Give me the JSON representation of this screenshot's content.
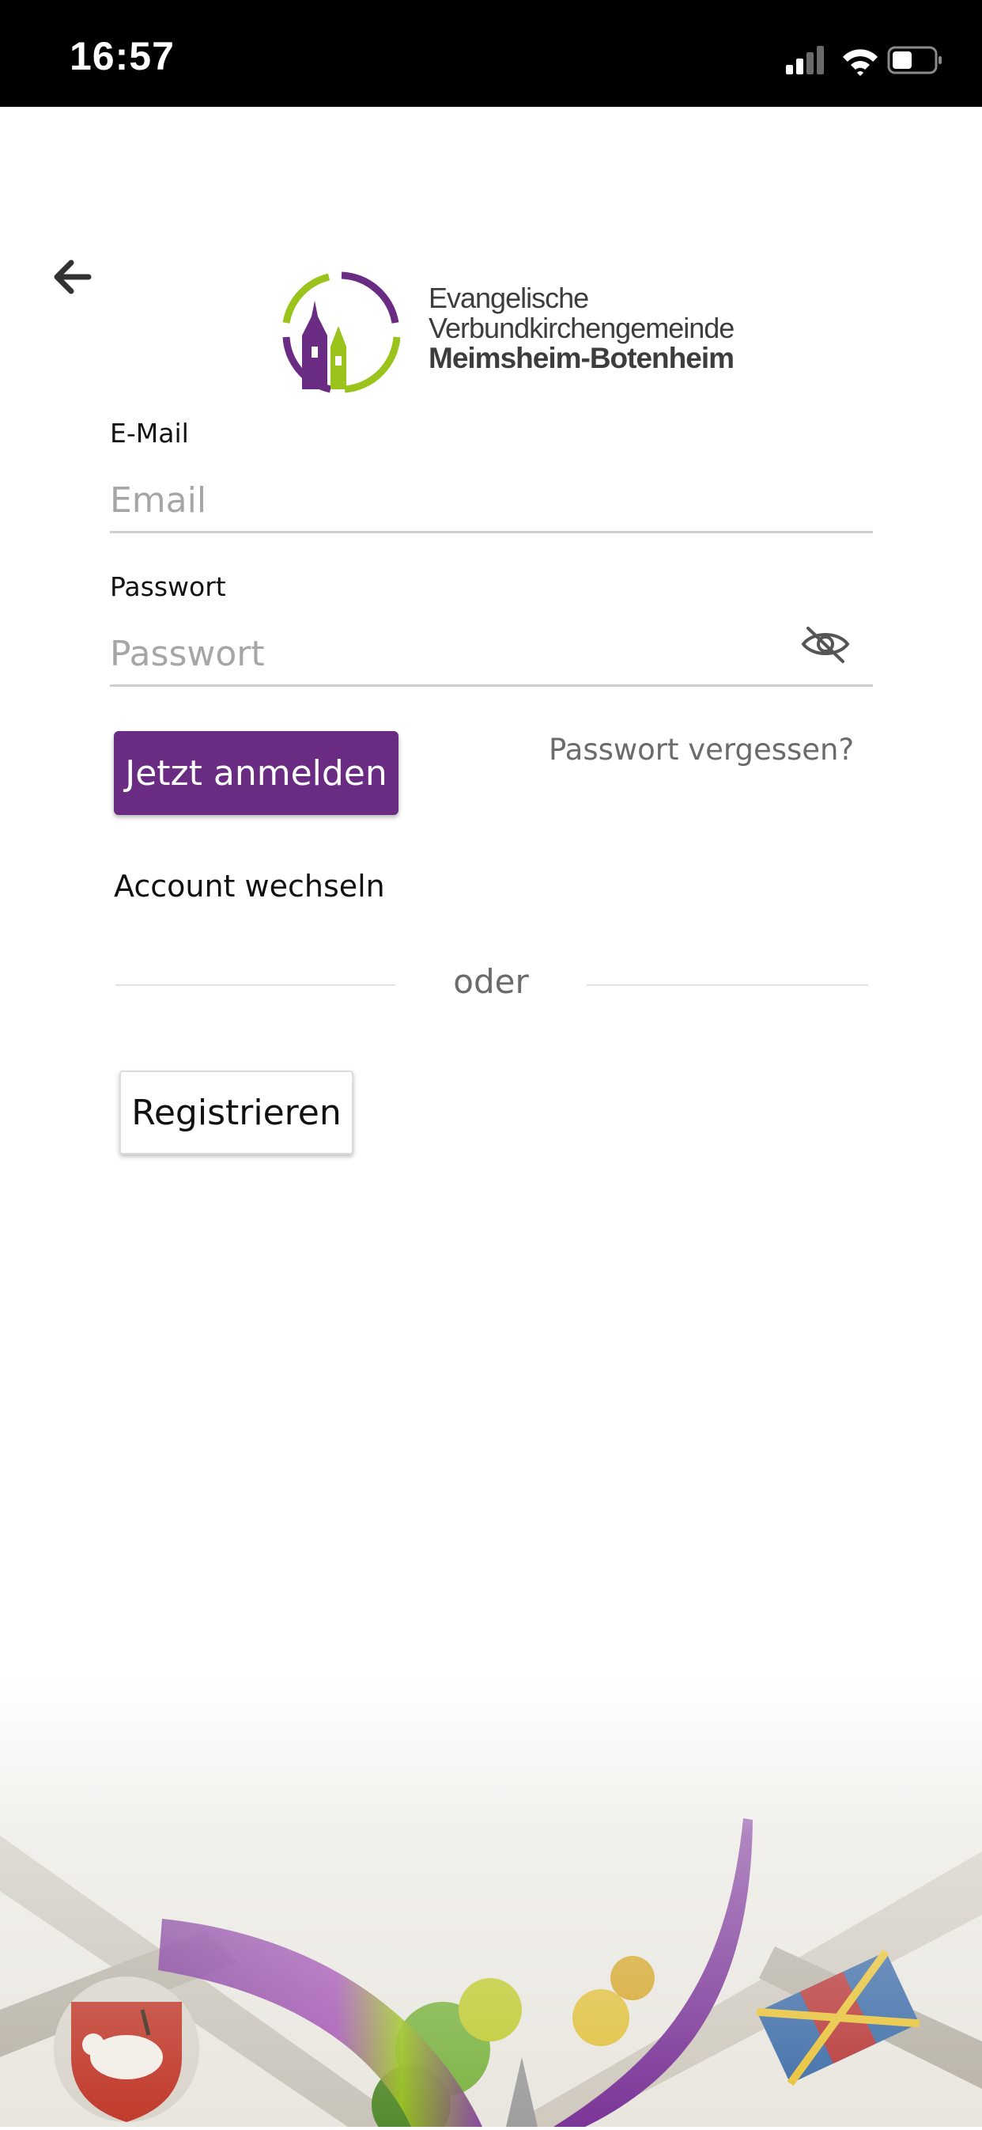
{
  "status_bar": {
    "time": "16:57"
  },
  "logo": {
    "line1": "Evangelische",
    "line2": "Verbundkirchengemeinde",
    "line3": "Meimsheim-Botenheim"
  },
  "email": {
    "label": "E-Mail",
    "placeholder": "Email",
    "value": ""
  },
  "password": {
    "label": "Passwort",
    "placeholder": "Passwort",
    "value": ""
  },
  "actions": {
    "login": "Jetzt anmelden",
    "forgot": "Passwort vergessen?",
    "switch_account": "Account wechseln",
    "divider": "oder",
    "register": "Registrieren"
  },
  "colors": {
    "brand_purple": "#6a2c83",
    "brand_green": "#9ac31c"
  }
}
